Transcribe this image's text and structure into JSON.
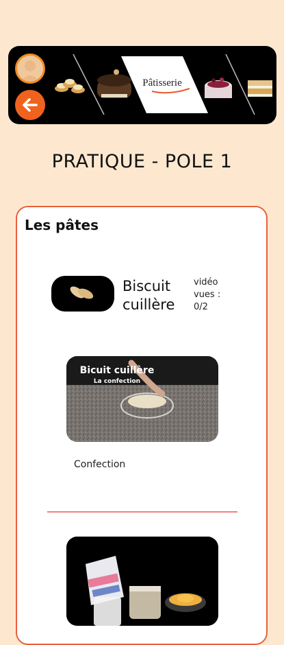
{
  "header": {
    "brand_text": "Pâtisserie",
    "back_button_label": "back",
    "colors": {
      "accent": "#f0631e",
      "avatar_border": "#f08c25",
      "banner_bg": "#000000"
    }
  },
  "page": {
    "title": "PRATIQUE - POLE 1"
  },
  "section": {
    "title": "Les pâtes",
    "lesson": {
      "title_line1": "Biscuit",
      "title_line2": "cuillère",
      "views_line1": "vidéo",
      "views_line2": "vues :",
      "views_line3": "0/2"
    },
    "videos": [
      {
        "overlay_title": "Bicuit cuillère",
        "overlay_subtitle": "La confection",
        "label": "Confection"
      },
      {
        "overlay_title": "",
        "overlay_subtitle": "",
        "label": ""
      }
    ],
    "colors": {
      "card_border": "#e8603c",
      "divider": "#ef8080"
    }
  },
  "icons": {
    "avatar": "user-avatar-icon",
    "back": "arrow-left-icon"
  }
}
